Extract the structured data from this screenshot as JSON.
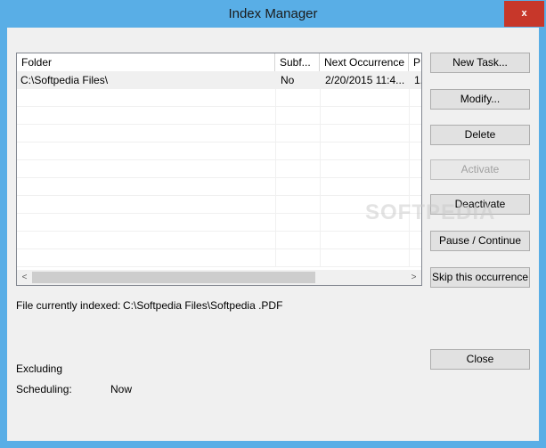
{
  "window": {
    "title": "Index Manager",
    "close_label": "x"
  },
  "table": {
    "columns": [
      "Folder",
      "Subf...",
      "Next Occurrence",
      "P"
    ],
    "rows": [
      {
        "folder": "C:\\Softpedia Files\\",
        "subfolders": "No",
        "next": "2/20/2015 11:4...",
        "p": "1."
      }
    ]
  },
  "scrollbar": {
    "left_arrow": "<",
    "right_arrow": ">"
  },
  "buttons": {
    "new_task": "New Task...",
    "modify": "Modify...",
    "delete": "Delete",
    "activate": "Activate",
    "deactivate": "Deactivate",
    "pause_continue": "Pause / Continue",
    "skip": "Skip this occurrence",
    "close": "Close"
  },
  "status": {
    "file_indexed_label": "File currently indexed:",
    "file_indexed_value": "C:\\Softpedia Files\\Softpedia .PDF",
    "excluding_label": "Excluding",
    "scheduling_label": "Scheduling:",
    "scheduling_value": "Now"
  },
  "watermark": "SOFTPEDIA"
}
